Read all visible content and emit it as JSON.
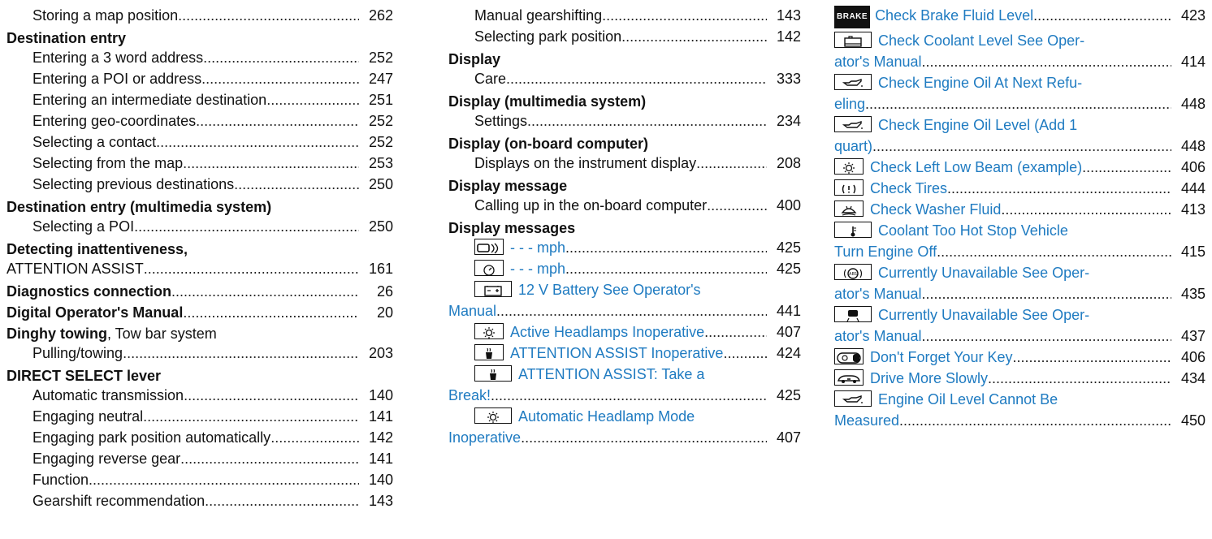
{
  "col1": [
    {
      "kind": "sub",
      "text": "Storing a map position",
      "page": "262"
    },
    {
      "kind": "head",
      "text": "Destination entry"
    },
    {
      "kind": "sub",
      "text": "Entering a 3 word address",
      "page": "252"
    },
    {
      "kind": "sub",
      "text": "Entering a POI or address",
      "page": "247"
    },
    {
      "kind": "sub",
      "text": "Entering an intermediate destination",
      "page": "251"
    },
    {
      "kind": "sub",
      "text": "Entering geo-coordinates",
      "page": "252"
    },
    {
      "kind": "sub",
      "text": "Selecting a contact",
      "page": "252"
    },
    {
      "kind": "sub",
      "text": "Selecting from the map",
      "page": "253"
    },
    {
      "kind": "sub",
      "text": "Selecting previous destinations",
      "page": "250"
    },
    {
      "kind": "head",
      "text": "Destination entry (multimedia system)"
    },
    {
      "kind": "sub",
      "text": "Selecting a POI",
      "page": "250"
    },
    {
      "kind": "head",
      "text": "Detecting inattentiveness,",
      "extra": ""
    },
    {
      "kind": "cont",
      "text": "ATTENTION ASSIST",
      "page": "161"
    },
    {
      "kind": "mainpage",
      "text": "Diagnostics connection",
      "page": "26"
    },
    {
      "kind": "mainpage",
      "text": "Digital Operator's Manual",
      "page": "20"
    },
    {
      "kind": "headplain",
      "text": "Dinghy towing",
      "extra": ", Tow bar system"
    },
    {
      "kind": "sub",
      "text": "Pulling/towing",
      "page": "203"
    },
    {
      "kind": "head",
      "text": "DIRECT SELECT lever"
    },
    {
      "kind": "sub",
      "text": "Automatic transmission",
      "page": "140"
    },
    {
      "kind": "sub",
      "text": "Engaging neutral",
      "page": "141"
    },
    {
      "kind": "sub",
      "text": "Engaging park position automatically",
      "page": "142"
    },
    {
      "kind": "sub",
      "text": "Engaging reverse gear",
      "page": "141"
    },
    {
      "kind": "sub",
      "text": "Function",
      "page": "140"
    },
    {
      "kind": "sub",
      "text": "Gearshift recommendation",
      "page": "143"
    }
  ],
  "col2": [
    {
      "kind": "sub",
      "text": "Manual gearshifting",
      "page": "143"
    },
    {
      "kind": "sub",
      "text": "Selecting park position",
      "page": "142"
    },
    {
      "kind": "head",
      "text": "Display"
    },
    {
      "kind": "sub",
      "text": "Care",
      "page": "333"
    },
    {
      "kind": "head",
      "text": "Display (multimedia system)"
    },
    {
      "kind": "sub",
      "text": "Settings",
      "page": "234"
    },
    {
      "kind": "head",
      "text": "Display (on-board computer)"
    },
    {
      "kind": "sub",
      "text": "Displays on the instrument display",
      "page": "208"
    },
    {
      "kind": "head",
      "text": "Display message"
    },
    {
      "kind": "sub",
      "text": "Calling up in the on-board computer",
      "page": "400"
    },
    {
      "kind": "head",
      "text": "Display messages"
    },
    {
      "kind": "icon",
      "icon": "distance-pilot-icon",
      "text": "- - - mph",
      "page": "425"
    },
    {
      "kind": "icon",
      "icon": "speed-limiter-icon",
      "text": "- - - mph",
      "page": "425"
    },
    {
      "kind": "icon2",
      "icon": "battery-icon",
      "text": "12 V Battery See Operator's",
      "cont": "Manual",
      "page": "441"
    },
    {
      "kind": "icon",
      "icon": "headlamp-icon",
      "text": "Active Headlamps Inoperative",
      "page": "407"
    },
    {
      "kind": "icon",
      "icon": "coffee-cup-icon",
      "text": "ATTENTION ASSIST Inoperative",
      "page": "424"
    },
    {
      "kind": "icon2",
      "icon": "coffee-cup-icon",
      "text": "ATTENTION ASSIST: Take a",
      "cont": "Break!",
      "page": "425"
    },
    {
      "kind": "icon2",
      "icon": "headlamp-icon",
      "text": "Automatic Headlamp Mode",
      "cont": "Inoperative",
      "page": "407"
    }
  ],
  "col3": [
    {
      "kind": "brake",
      "icon": "brake-icon",
      "badge": "BRAKE",
      "text": "Check Brake Fluid Level",
      "page": "423"
    },
    {
      "kind": "icon2",
      "icon": "coolant-level-icon",
      "text": "Check Coolant Level See Oper-",
      "cont": "ator's Manual",
      "page": "414"
    },
    {
      "kind": "icon2",
      "icon": "oil-can-icon",
      "text": "Check Engine Oil At Next Refu-",
      "cont": "eling",
      "page": "448"
    },
    {
      "kind": "icon2",
      "icon": "oil-can-icon",
      "text": "Check Engine Oil Level (Add 1",
      "cont": "quart)",
      "page": "448"
    },
    {
      "kind": "icon",
      "icon": "headlamp-icon",
      "text": "Check Left Low Beam (example)",
      "page": "406"
    },
    {
      "kind": "icon",
      "icon": "tire-pressure-icon",
      "text": "Check Tires",
      "page": "444"
    },
    {
      "kind": "icon",
      "icon": "washer-fluid-icon",
      "text": "Check Washer Fluid",
      "page": "413"
    },
    {
      "kind": "icon2",
      "icon": "coolant-temp-icon",
      "text": "Coolant Too Hot Stop Vehicle",
      "cont": "Turn Engine Off",
      "page": "415"
    },
    {
      "kind": "icon2",
      "icon": "abs-icon",
      "text": "Currently Unavailable See Oper-",
      "cont": "ator's Manual",
      "page": "435"
    },
    {
      "kind": "icon2",
      "icon": "lane-keep-icon",
      "text": "Currently Unavailable See Oper-",
      "cont": "ator's Manual",
      "page": "437"
    },
    {
      "kind": "icon",
      "icon": "key-icon",
      "text": "Don't Forget Your Key",
      "page": "406"
    },
    {
      "kind": "icon",
      "icon": "drive-slowly-icon",
      "text": "Drive More Slowly",
      "page": "434"
    },
    {
      "kind": "icon2",
      "icon": "oil-can-icon",
      "text": "Engine Oil Level Cannot Be",
      "cont": "Measured",
      "page": "450"
    }
  ]
}
